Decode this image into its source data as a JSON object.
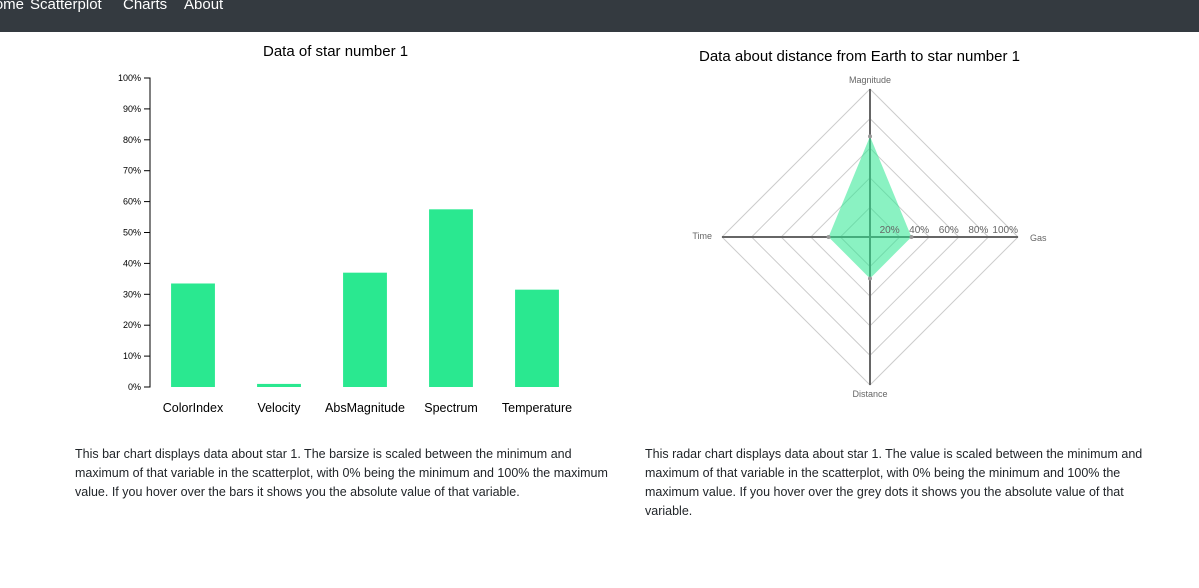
{
  "nav": {
    "items": [
      {
        "label": "Home"
      },
      {
        "label": "Scatterplot"
      },
      {
        "label": "Charts"
      },
      {
        "label": "About"
      }
    ]
  },
  "bar_section": {
    "description": "This bar chart displays data about star 1. The barsize is scaled between the minimum and maximum of that variable in the scatterplot, with 0% being the minimum and 100% the maximum value. If you hover over the bars it shows you the absolute value of that variable."
  },
  "radar_section": {
    "description": "This radar chart displays data about star 1. The value is scaled between the minimum and maximum of that variable in the scatterplot, with 0% being the minimum and 100% the maximum value. If you hover over the grey dots it shows you the absolute value of that variable."
  },
  "chart_data": [
    {
      "type": "bar",
      "title": "Data of star number 1",
      "categories": [
        "ColorIndex",
        "Velocity",
        "AbsMagnitude",
        "Spectrum",
        "Temperature"
      ],
      "values": [
        33.5,
        1,
        37,
        57.5,
        31.5
      ],
      "y_ticks": [
        "0%",
        "10%",
        "20%",
        "30%",
        "40%",
        "50%",
        "60%",
        "70%",
        "80%",
        "90%",
        "100%"
      ],
      "ylim": [
        0,
        100
      ],
      "bar_color": "#2ae890",
      "grid": false
    },
    {
      "type": "radar",
      "title": "Data about distance from Earth to star number 1",
      "axes": [
        "Magnitude",
        "Gas",
        "Distance",
        "Time"
      ],
      "values": [
        68,
        28,
        28,
        28
      ],
      "rings": [
        "20%",
        "40%",
        "60%",
        "80%",
        "100%"
      ],
      "range": [
        0,
        100
      ],
      "fill_color": "#2ae890",
      "ring_color": "#cccccc",
      "axis_color": "#666666",
      "point_color": "#999999"
    }
  ]
}
